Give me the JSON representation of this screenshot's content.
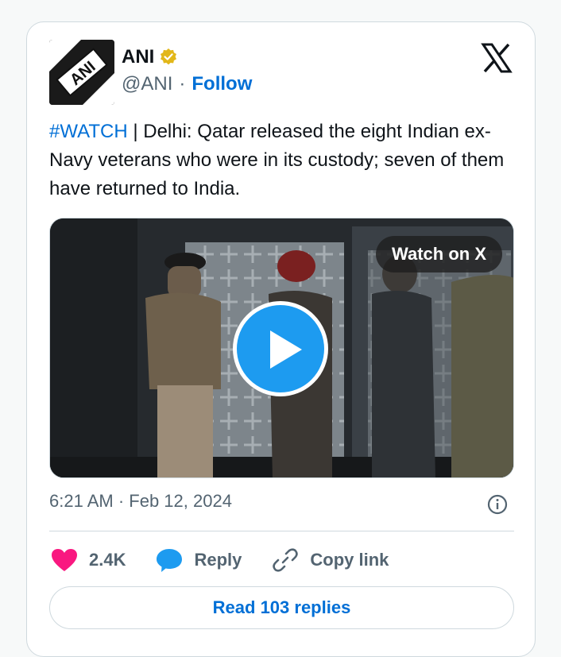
{
  "author": {
    "name": "ANI",
    "handle": "@ANI",
    "separator": "·",
    "follow_label": "Follow",
    "logo_text": "ANI"
  },
  "tweet": {
    "hashtag": "#WATCH",
    "text": " | Delhi: Qatar released the eight Indian ex-Navy veterans who were in its custody; seven of them have returned to India."
  },
  "media": {
    "watch_label": "Watch on X"
  },
  "meta": {
    "time": "6:21 AM · Feb 12, 2024"
  },
  "actions": {
    "likes": "2.4K",
    "reply_label": "Reply",
    "copy_label": "Copy link"
  },
  "read_replies_label": "Read 103 replies",
  "colors": {
    "accent": "#1d9bf0",
    "link": "#006fd6",
    "heart": "#f91880",
    "verified": "#e2b719"
  },
  "icons": [
    "x-logo-icon",
    "verified-badge-icon",
    "play-icon",
    "info-icon",
    "heart-icon",
    "reply-icon",
    "link-icon"
  ]
}
